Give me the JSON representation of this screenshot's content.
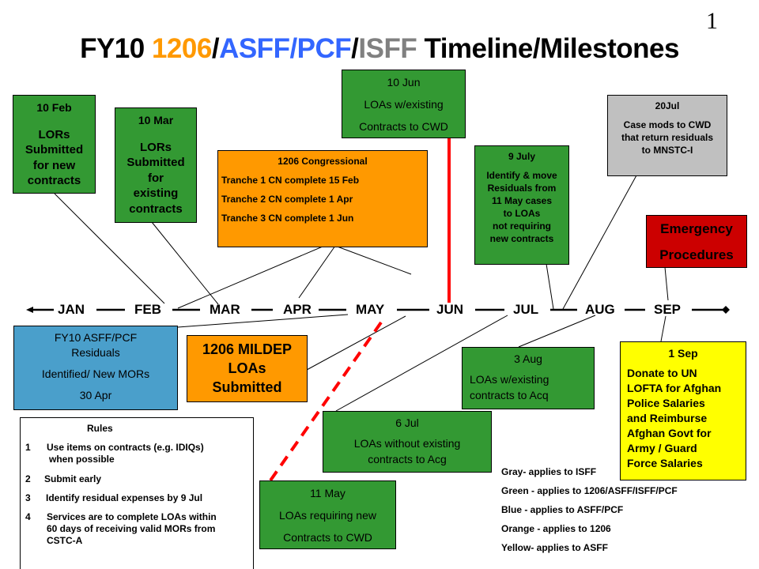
{
  "slide_number": "1",
  "title": {
    "parts": [
      {
        "text": "FY10 ",
        "color": "#000000"
      },
      {
        "text": "1206",
        "color": "#ff9900"
      },
      {
        "text": "/",
        "color": "#000000"
      },
      {
        "text": "ASFF/PCF",
        "color": "#3366ff"
      },
      {
        "text": "/",
        "color": "#000000"
      },
      {
        "text": "ISFF",
        "color": "#808080"
      },
      {
        "text": " Timeline/Milestones",
        "color": "#000000"
      }
    ]
  },
  "colors": {
    "green": "#339933",
    "orange": "#ff9900",
    "blue": "#4a9fcb",
    "gray": "#c0c0c0",
    "red": "#cc0000",
    "yellow": "#ffff00",
    "critical_line": "#ff0000"
  },
  "timeline": {
    "months": [
      "JAN",
      "FEB",
      "MAR",
      "APR",
      "MAY",
      "JUN",
      "JUL",
      "AUG",
      "SEP"
    ]
  },
  "milestones": {
    "feb10": {
      "date": "10 Feb",
      "lines": [
        "LORs",
        "Submitted",
        "for new",
        "contracts"
      ]
    },
    "mar10": {
      "date": "10 Mar",
      "lines": [
        "LORs",
        "Submitted",
        "for",
        "existing",
        "contracts"
      ]
    },
    "congressional": {
      "title": "1206 Congressional",
      "lines": [
        "Tranche 1 CN complete 15 Feb",
        "Tranche 2 CN complete 1 Apr",
        "Tranche 3 CN complete 1 Jun"
      ]
    },
    "jun10": {
      "date": "10 Jun",
      "lines": [
        "LOAs w/existing",
        "Contracts to CWD"
      ]
    },
    "jul9": {
      "date": "9 July",
      "lines": [
        "Identify & move",
        "Residuals from",
        "11 May cases",
        "to LOAs",
        "not requiring",
        "new contracts"
      ]
    },
    "jul20": {
      "date": "20Jul",
      "lines": [
        "Case mods to CWD",
        "that return residuals",
        "to MNSTC-I"
      ]
    },
    "emergency": {
      "lines": [
        "Emergency",
        "Procedures"
      ]
    },
    "residuals": {
      "lines": [
        "FY10 ASFF/PCF",
        "Residuals",
        "Identified/ New MORs",
        "30 Apr"
      ]
    },
    "mildep": {
      "lines": [
        "1206 MILDEP",
        "LOAs",
        "Submitted"
      ]
    },
    "aug3": {
      "date": "3 Aug",
      "lines": [
        "LOAs w/existing",
        "contracts to Acq"
      ]
    },
    "jul6": {
      "date": "6 Jul",
      "lines": [
        "LOAs without existing",
        "contracts to Acg"
      ]
    },
    "may11": {
      "date": "11 May",
      "lines": [
        "LOAs requiring new",
        "Contracts to CWD"
      ]
    },
    "sep1": {
      "date": "1 Sep",
      "lines": [
        "Donate to UN",
        "LOFTA for Afghan",
        "Police Salaries",
        "and Reimburse",
        "Afghan Govt for",
        "Army / Guard",
        "Force Salaries"
      ]
    }
  },
  "rules": {
    "title": "Rules",
    "items": [
      {
        "num": "1",
        "text": [
          "Use items on contracts  (e.g. IDIQs)",
          "when possible"
        ]
      },
      {
        "num": "2",
        "text": [
          "Submit early"
        ]
      },
      {
        "num": "3",
        "text": [
          "Identify residual expenses   by 9 Jul"
        ]
      },
      {
        "num": "4",
        "text": [
          "Services are to complete LOAs within",
          "60 days of receiving valid MORs from",
          "CSTC-A"
        ]
      }
    ]
  },
  "legend": [
    "Gray- applies to  ISFF",
    "Green - applies to 1206/ASFF/ISFF/PCF",
    "Blue - applies to ASFF/PCF",
    "Orange -  applies to 1206",
    "Yellow- applies to ASFF"
  ]
}
